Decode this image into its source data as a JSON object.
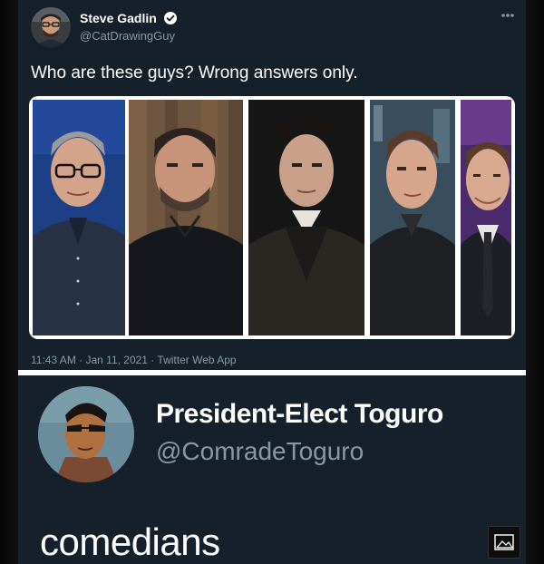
{
  "tweet1": {
    "display_name": "Steve Gadlin",
    "handle": "@CatDrawingGuy",
    "text": "Who are these guys? Wrong answers only.",
    "meta": "11:43 AM · Jan 11, 2021 · Twitter Web App",
    "more_icon": "more-dots-icon",
    "verified_icon": "verified-badge-icon"
  },
  "tweet2": {
    "display_name": "President-Elect Toguro",
    "handle": "@ComradeToguro",
    "text": "comedians",
    "image_button_icon": "image-icon"
  },
  "colors": {
    "background": "#15202b",
    "text_primary": "#ffffff",
    "text_secondary": "#8899a6",
    "accent": "#1da1f2"
  }
}
